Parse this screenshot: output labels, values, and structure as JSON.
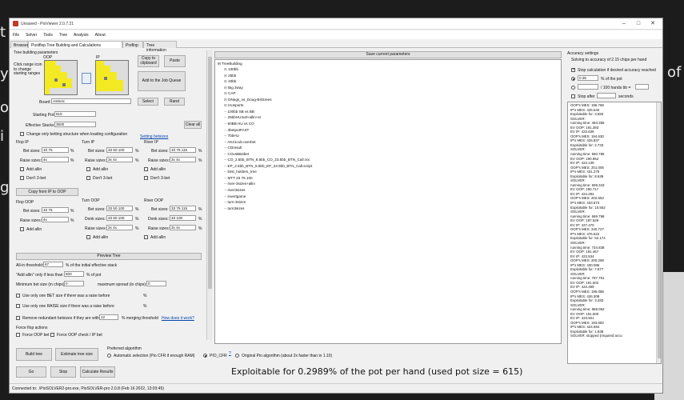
{
  "background": {
    "left_glyphs": [
      "t",
      "y",
      "o",
      "i",
      "g"
    ],
    "right_glyph": "of"
  },
  "window": {
    "title": "Unsaved - PioViewer 2.0.7.21"
  },
  "menu": [
    "File",
    "Solver",
    "Tools",
    "Tree",
    "Analysis",
    "About"
  ],
  "tabs": [
    "Browser",
    "Postflop Tree Building and Calculations",
    "Preflop",
    "Tree information"
  ],
  "tree_params": {
    "header": "Tree building parameters",
    "oop_label": "OOP",
    "ip_label": "IP",
    "range_hint": "Click range icon to change starting ranges",
    "copy_clipboard": "Copy to clipboard",
    "paste": "Paste",
    "add_queue": "Add to the Job Queue",
    "board_label": "Board:",
    "board_value": "As6s4c",
    "select": "Select",
    "rand": "Rand",
    "starting_pot_label": "Starting Pot:",
    "starting_pot_value": "615",
    "eff_stack_label": "Effective Stacks:",
    "eff_stack_value": "3500",
    "clear_all": "Clear all",
    "change_only": "Change only betting structure when loading configuration",
    "setting_betsizes": "Setting betsizes"
  },
  "ip_section": {
    "flop_title": "Flop IP",
    "turn_title": "Turn IP",
    "river_title": "River IP",
    "bet_label": "Bet sizes:",
    "raise_label": "Raise sizes:",
    "donk_label": "Donk sizes:",
    "add_allin": "Add allin",
    "dont3bet": "Don't 3-bet",
    "flop_bet": "33 75",
    "flop_raise": "4x",
    "turn_bet": "33 50 100",
    "turn_raise": "3x 4x",
    "river_bet": "33 75 115",
    "river_raise": "3x 4x",
    "copy_ip_oop": "Copy from IP to OOP"
  },
  "oop_section": {
    "flop_title": "Flop OOP",
    "turn_title": "Turn OOP",
    "river_title": "River OOP",
    "flop_bet": "33 75",
    "flop_raise": "4x",
    "turn_bet": "33 50 100",
    "turn_donk": "33 50 100",
    "turn_raise": "3x 4x",
    "river_bet": "33 75 115",
    "river_donk": "33 100",
    "river_raise": "3x 4x"
  },
  "misc": {
    "preview_tree": "Preview Tree",
    "allin_threshold_label": "All-in threshold:",
    "allin_threshold_value": "67",
    "allin_threshold_suffix": "% of the initial effective stack",
    "add_allin_only_label": "\"Add allin\" only if less than",
    "add_allin_only_value": "500",
    "add_allin_only_suffix": "% of pot",
    "min_bet_label": "Minimum bet size (in chips):",
    "min_bet_value": "0",
    "max_spread_label": "maximum spread (in chips):",
    "max_spread_value": "0",
    "one_bet": "Use only one BET size if there was a raise before",
    "one_raise": "Use only one RAISE size if there was a raise before",
    "remove_redundant": "Remove redundant betsizes if they are within",
    "remove_value": "12",
    "merging": "% merging threshold",
    "how_work": "How does it work?",
    "force_flop": "Force flop actions",
    "force_oop_bet": "Force OOP bet",
    "force_oop_check": "Force OOP check / IP bet"
  },
  "actions": {
    "build_tree": "Build tree",
    "estimate": "Estimate tree size",
    "go": "Go",
    "stop": "Stop",
    "calc": "Calculate Results"
  },
  "algorithm": {
    "title": "Preferred algorithm",
    "auto": "Automatic selection (Pio CFR if enough RAM)",
    "pio_cfr": "PIO_CFR",
    "original": "Original Pio algorithm (about 2x faster than in 1.10)"
  },
  "tree_panel": {
    "save_button": "Save current parameters",
    "root": "TreeBuilding",
    "items": [
      "100bb",
      "25bb",
      "40bb",
      "Big 3way",
      "CAP",
      "DNegs_vs_Doug-BIGtrees",
      "HUsports",
      "100bb SB vs BB",
      "25bbHU4utl+allin+er",
      "50BB HU vs CO",
      "3betpotFAST",
      "7bbHU",
      "AK21cub.overbet",
      "CDresult",
      "COvsBB3bet",
      "CO_2.5bb_BTN_8.5bb_CO_23.5bb_BTN_Call.rxx",
      "EP_2.5bb_BTN_8.5bb_EP_23.5bb_BTN_Call.script",
      "limit_holdem_tree",
      "MTT 33 75 100",
      "river-3sizes+allin",
      "river3sizes",
      "invertgame",
      "turn-3sizes",
      "turn3sizes"
    ]
  },
  "accuracy": {
    "title": "Accuracy settings",
    "solving_to": "Solving to accuracy of 2.15 chips per hand",
    "stop_calc": "Stop calculation if desired accuracy reached",
    "pct_value": "0.35",
    "pct_label": "% of the pot",
    "chips_label": "/ 100 hands  bb =",
    "stop_after": "Stop after",
    "seconds": "seconds"
  },
  "log": [
    "OOP's MES: 195.768",
    "IP's MES: 426.640",
    "Exploitable for: 3.683",
    "SOLVER:",
    "running time: 493.355",
    "EV OOP: 191.393",
    "EV IP: 423.636",
    "OOP's MES: 194.630",
    "IP's MES: 425.837",
    "Exploitable for: 2.733",
    "SOLVER:",
    "running time: 550.785",
    "EV OOP: 190.952",
    "EV IP: 424.139",
    "OOP's MES: 201.005",
    "IP's MES: 431.275",
    "Exploitable for: 8.639",
    "SOLVER:",
    "running time: 608.343",
    "EV OOP: 190.717",
    "EV IP: 424.284",
    "OOP's MES: 202.553",
    "IP's MES: 433.573",
    "Exploitable for: 10.562",
    "SOLVER:",
    "running time: 669.798",
    "EV OOP: 187.529",
    "EV IP: 427.470",
    "OOP's MES: 240.727",
    "IP's MES: 476.622",
    "Exploitable for: 52.174",
    "SOLVER:",
    "running time: 734.838",
    "EV OOP: 191.467",
    "EV IP: 423.534",
    "OOP's MES: 200.268",
    "IP's MES: 430.086",
    "Exploitable for: 7.677",
    "SOLVER:",
    "running time: 797.761",
    "EV OOP: 191.502",
    "EV IP: 423.499",
    "OOP's MES: 195.088",
    "IP's MES: 426.308",
    "Exploitable for: 3.283",
    "SOLVER:",
    "running time: 858.052",
    "EV OOP: 191.500",
    "EV IP: 423.501",
    "OOP's MES: 193.682",
    "IP's MES: 424.594",
    "Exploitable for: 1.838",
    "SOLVER: stopped (required accu"
  ],
  "exploitable_banner": "Exploitable for 0.2989% of the pot per hand (used pot size = 615)",
  "status": "Connected to: .\\PioSOLVER2-pro.exe, PioSOLVER-pro 2.0.8 (Feb 16 2022, 13:03:45)"
}
